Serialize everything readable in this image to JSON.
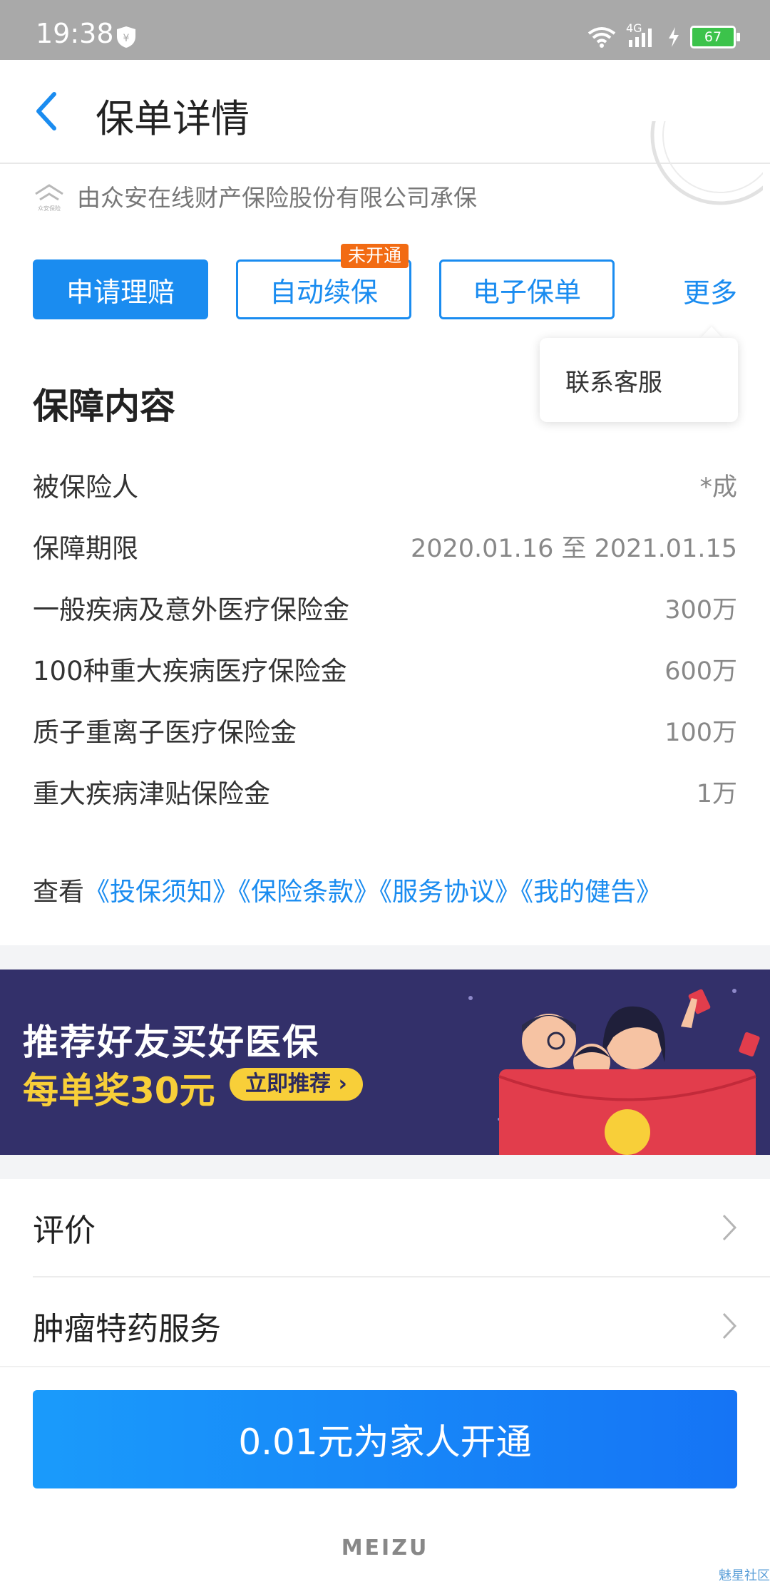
{
  "status_bar": {
    "time": "19:38",
    "network": "4G",
    "battery": "67"
  },
  "header": {
    "title": "保单详情"
  },
  "insurer": {
    "text": "由众安在线财产保险股份有限公司承保",
    "logo_caption": "众安保险"
  },
  "actions": {
    "claim": "申请理赔",
    "auto_renew": "自动续保",
    "auto_renew_badge": "未开通",
    "e_policy": "电子保单",
    "more": "更多"
  },
  "popover": {
    "contact": "联系客服"
  },
  "coverage": {
    "title": "保障内容",
    "rows": [
      {
        "label": "被保险人",
        "value": "*成"
      },
      {
        "label": "保障期限",
        "value": "2020.01.16 至 2021.01.15"
      },
      {
        "label": "一般疾病及意外医疗保险金",
        "value": "300万"
      },
      {
        "label": "100种重大疾病医疗保险金",
        "value": "600万"
      },
      {
        "label": "质子重离子医疗保险金",
        "value": "100万"
      },
      {
        "label": "重大疾病津贴保险金",
        "value": "1万"
      }
    ]
  },
  "docs": {
    "prefix": "查看",
    "links": [
      "《投保须知》",
      "《保险条款》",
      "《服务协议》",
      "《我的健告》"
    ]
  },
  "banner": {
    "title": "推荐好友买好医保",
    "subtitle": "每单奖30元",
    "cta": "立即推荐 ›"
  },
  "list": [
    {
      "label": "评价"
    },
    {
      "label": "肿瘤特药服务"
    }
  ],
  "bottom": {
    "cta": "0.01元为家人开通",
    "brand": "MEIZU",
    "watermark": "魅星社区"
  },
  "colors": {
    "accent": "#1a8cf0",
    "badge": "#f26b13",
    "banner_bg": "#33306a",
    "banner_yellow": "#f8cf39"
  }
}
